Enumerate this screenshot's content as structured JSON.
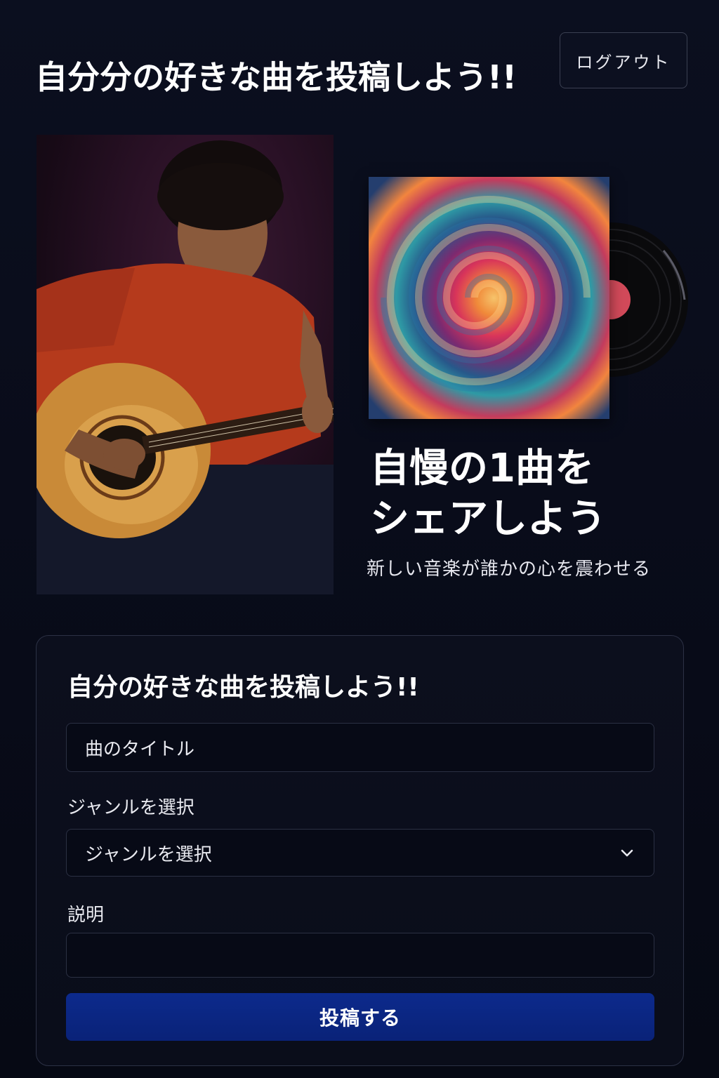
{
  "header": {
    "title": "自分分の好きな曲を投稿しよう!!",
    "logout_label": "ログアウト"
  },
  "hero": {
    "photo_alt": "",
    "heading_line1": "自慢の1曲を",
    "heading_line2": "シェアしよう",
    "subtext": "新しい音楽が誰かの心を震わせる"
  },
  "form": {
    "title": "自分の好きな曲を投稿しよう!!",
    "title_field_placeholder": "曲のタイトル",
    "genre_label": "ジャンルを選択",
    "genre_selected": "ジャンルを選択",
    "description_label": "説明",
    "description_value": "",
    "submit_label": "投稿する"
  },
  "colors": {
    "background": "#0a0d1a",
    "accent": "#0c2a8c",
    "border": "#2c3145"
  },
  "icons": {
    "select_icon": "chevron-down-icon"
  }
}
